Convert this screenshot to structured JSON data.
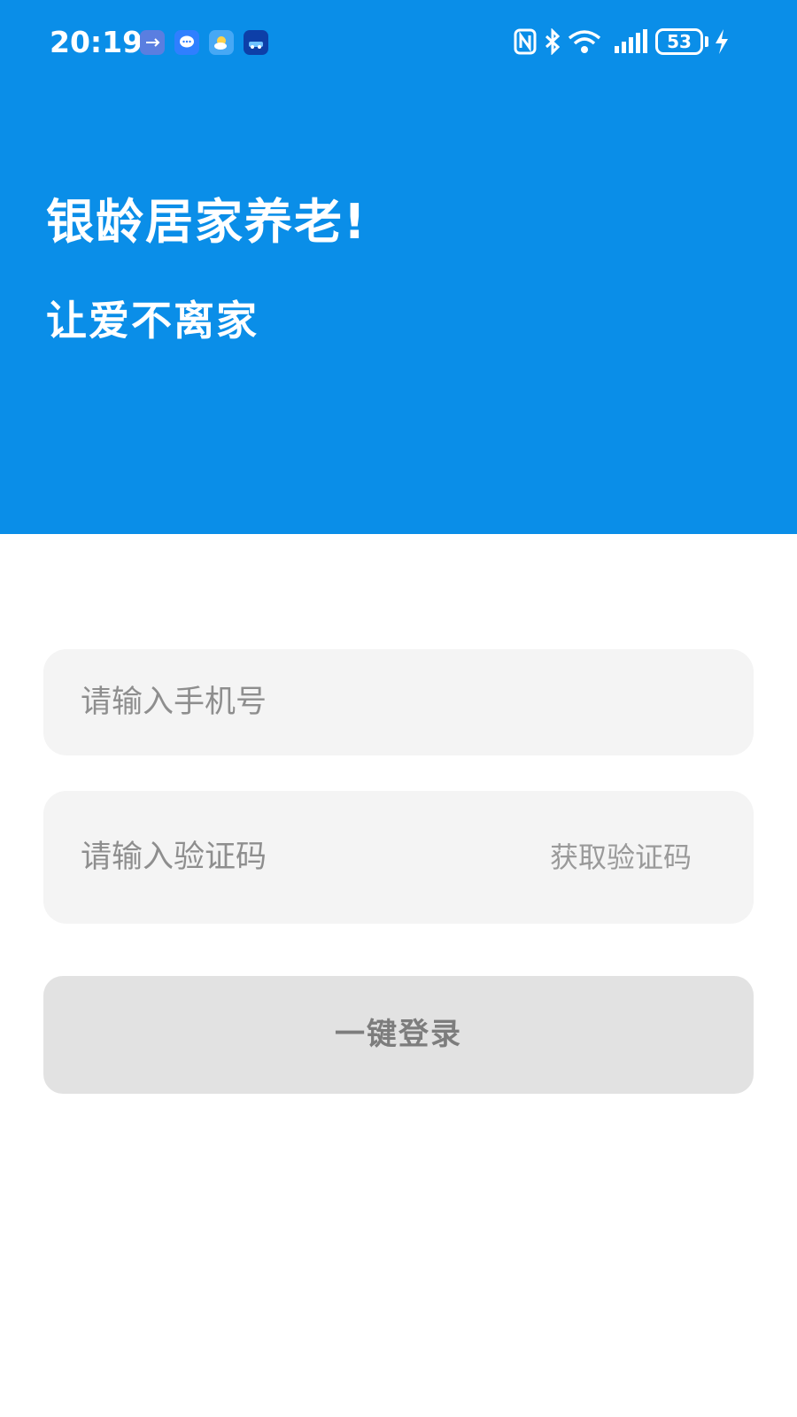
{
  "status_bar": {
    "time": "20:19",
    "battery_level": "53",
    "notification_icons": [
      "usb-icon",
      "message-icon",
      "weather-icon",
      "car-app-icon"
    ],
    "system_icons": [
      "nfc-icon",
      "bluetooth-icon",
      "wifi-icon",
      "signal-icon",
      "battery-icon",
      "charging-icon"
    ],
    "icon_color": "#ffffff"
  },
  "hero": {
    "title": "银龄居家养老!",
    "subtitle": "让爱不离家",
    "background_color": "#0a8ee8"
  },
  "form": {
    "phone_placeholder": "请输入手机号",
    "code_placeholder": "请输入验证码",
    "get_code_label": "获取验证码",
    "login_label": "一键登录",
    "field_background": "#f4f4f4",
    "button_background": "#e2e2e2"
  }
}
